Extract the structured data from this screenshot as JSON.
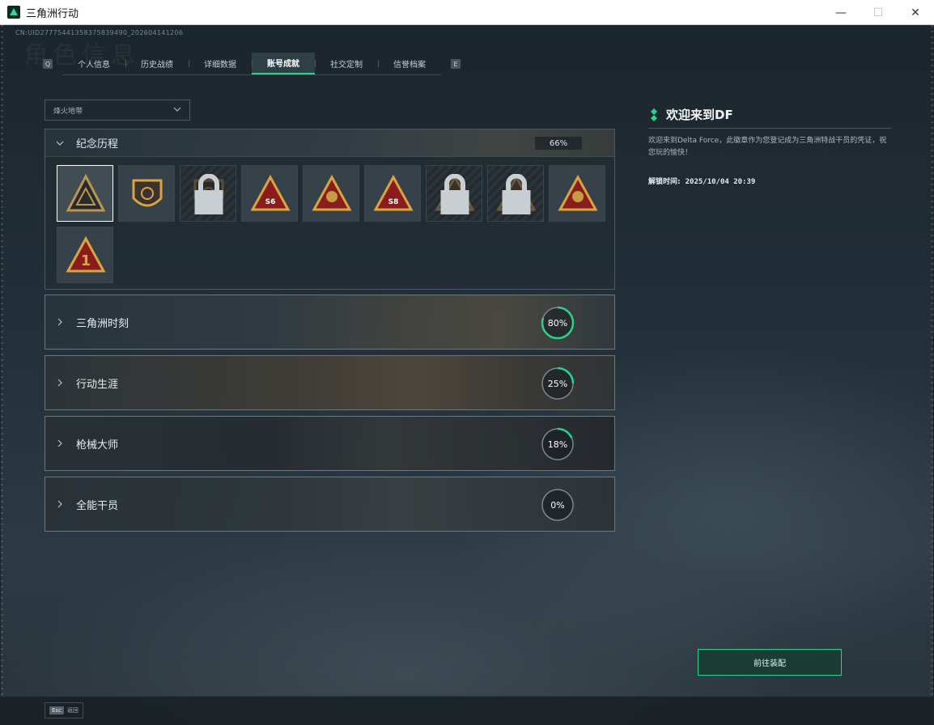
{
  "window": {
    "title": "三角洲行动",
    "controls": {
      "minimize": "—",
      "maximize": "☐",
      "close": "✕"
    }
  },
  "header": {
    "uid": "CN:UID2777544135837583949​0_202604141206",
    "watermark": "角色信息"
  },
  "tabs": {
    "left_key": "Q",
    "right_key": "E",
    "items": [
      {
        "label": "个人信息",
        "width": 78
      },
      {
        "label": "历史战绩",
        "width": 78
      },
      {
        "label": "详细数据",
        "width": 78
      },
      {
        "label": "账号成就",
        "width": 78,
        "active": true
      },
      {
        "label": "社交定制",
        "width": 78
      },
      {
        "label": "信誉档案",
        "width": 78
      }
    ]
  },
  "filter": {
    "selected": "烽火地带"
  },
  "commemorative": {
    "label": "纪念历程",
    "percent": "66%",
    "badges": [
      {
        "name": "delta-emblem",
        "locked": false,
        "selected": true
      },
      {
        "name": "helicopter",
        "locked": false
      },
      {
        "name": "dark-emblem",
        "locked": true
      },
      {
        "name": "s6-diamond",
        "locked": false,
        "text": "S6"
      },
      {
        "name": "lantern",
        "locked": false
      },
      {
        "name": "s8-tower",
        "locked": false,
        "text": "S8"
      },
      {
        "name": "operator-portrait",
        "locked": true
      },
      {
        "name": "skull-crossed",
        "locked": true
      },
      {
        "name": "sunrise-boat",
        "locked": false
      },
      {
        "name": "number-one",
        "locked": false,
        "text": "1"
      }
    ]
  },
  "categories": [
    {
      "label": "三角洲时刻",
      "percent_label": "80%",
      "progress": 0.8
    },
    {
      "label": "行动生涯",
      "percent_label": "25%",
      "progress": 0.25
    },
    {
      "label": "枪械大师",
      "percent_label": "18%",
      "progress": 0.18
    },
    {
      "label": "全能干员",
      "percent_label": "0%",
      "progress": 0.0
    }
  ],
  "info": {
    "title": "欢迎来到DF",
    "description": "欢迎来到Delta Force，此徽章作为您登记成为三角洲特战干员的凭证，祝您玩的愉快！",
    "unlock_label": "解锁时间:",
    "unlock_time": "2025/10/04 20:39"
  },
  "equip_button": {
    "label": "前往装配"
  },
  "footer": {
    "esc_key": "Esc",
    "back_label": "返回"
  },
  "colors": {
    "accent": "#2ad38a",
    "badge_gold": "#d9a543",
    "badge_red": "#8a1c1c"
  }
}
